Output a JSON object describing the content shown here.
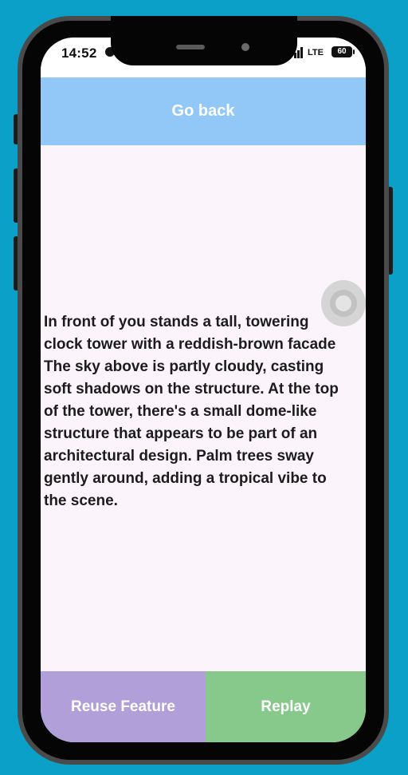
{
  "status_bar": {
    "time": "14:52",
    "network": "LTE",
    "battery": "60"
  },
  "header": {
    "go_back_label": "Go back"
  },
  "main": {
    "description": "In front of you stands a tall, towering\nclock tower with a reddish-brown facade\nThe sky above is partly cloudy, casting\nsoft shadows on the structure. At the top\nof the tower, there's a small dome-like\nstructure that appears to be part of an\narchitectural design. Palm trees sway\ngently around, adding a tropical vibe to\nthe scene."
  },
  "footer": {
    "reuse_label": "Reuse Feature",
    "replay_label": "Replay"
  },
  "colors": {
    "background": "#0aa0c8",
    "header": "#91c8f8",
    "reuse_button": "#b19fd9",
    "replay_button": "#86c98a",
    "screen": "#fcf4fb"
  },
  "icons": [
    "do-not-disturb-icon",
    "signal-icon",
    "battery-icon",
    "assistive-touch-icon"
  ]
}
